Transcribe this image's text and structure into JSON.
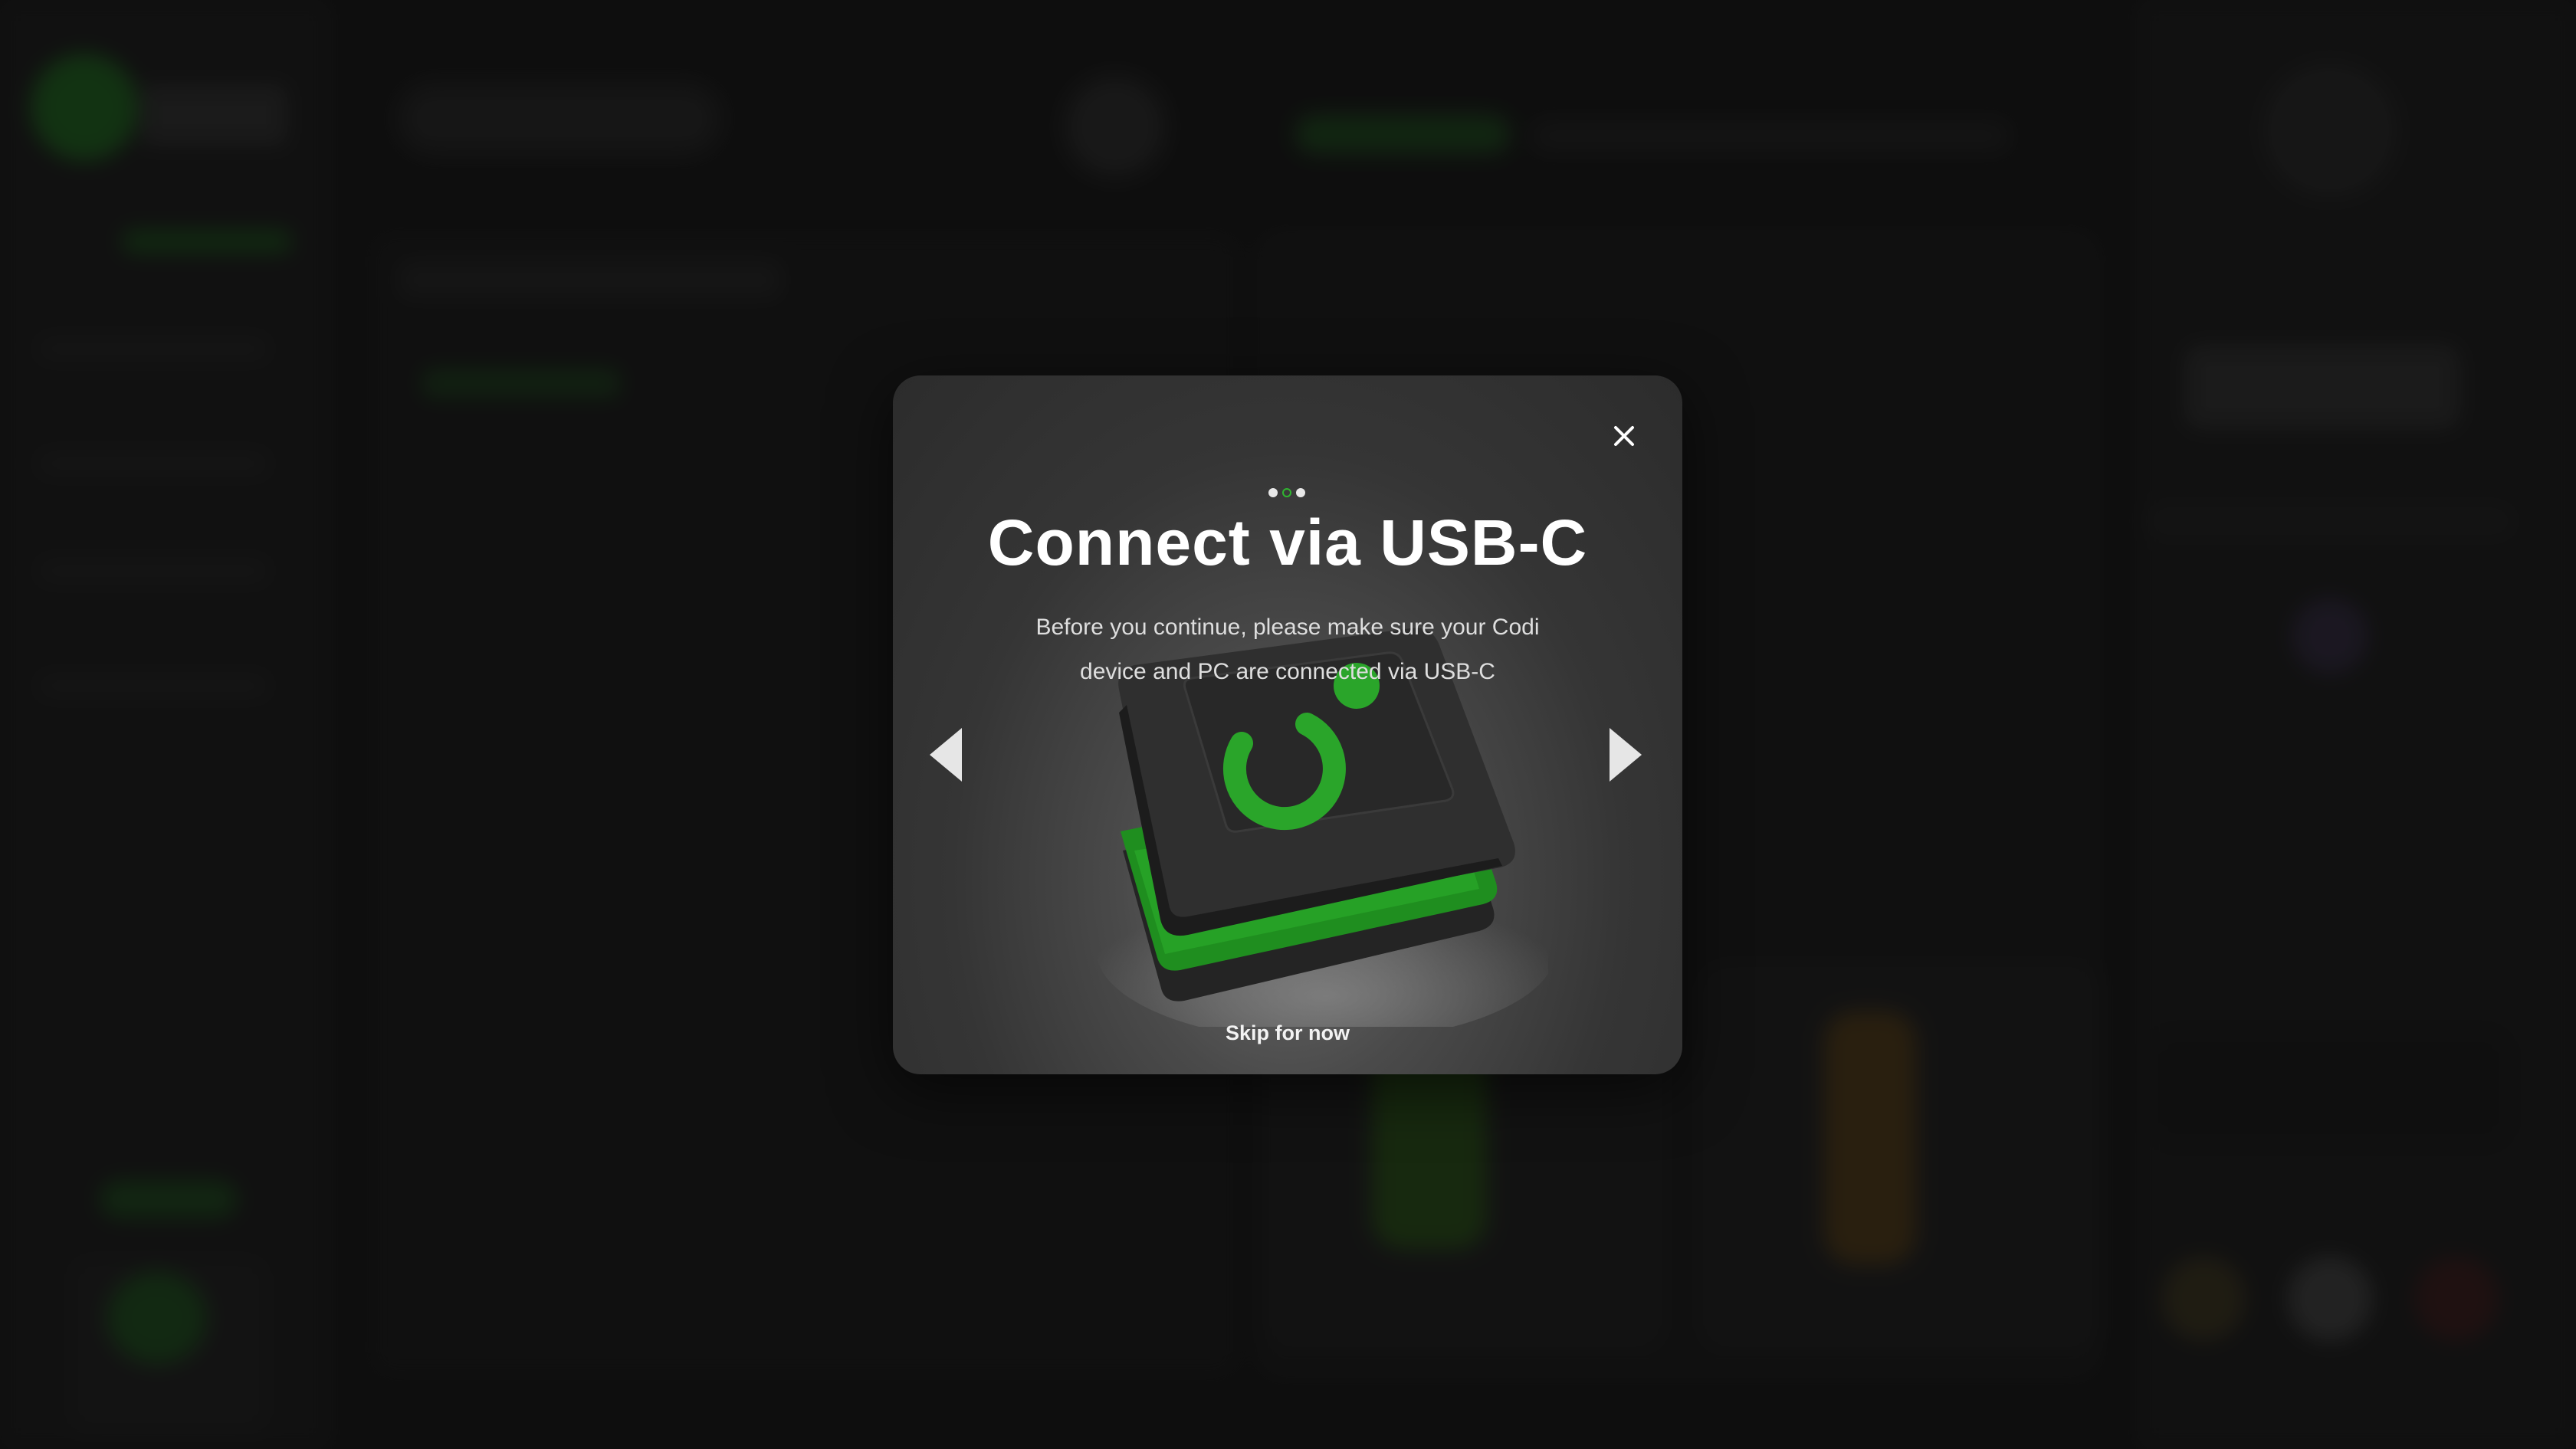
{
  "modal": {
    "title": "Connect via USB-C",
    "description": "Before you continue, please make sure your Codi device and PC are connected via USB-C",
    "skip_label": "Skip for now",
    "steps": {
      "total": 3,
      "current": 2
    },
    "icons": {
      "close": "close-icon",
      "prev": "arrow-left-icon",
      "next": "arrow-right-icon",
      "device": "codi-device-illustration"
    }
  },
  "colors": {
    "accent": "#2fb52f",
    "modal_bg": "#3a3a3a",
    "page_bg": "#121212",
    "text": "#ffffff"
  }
}
